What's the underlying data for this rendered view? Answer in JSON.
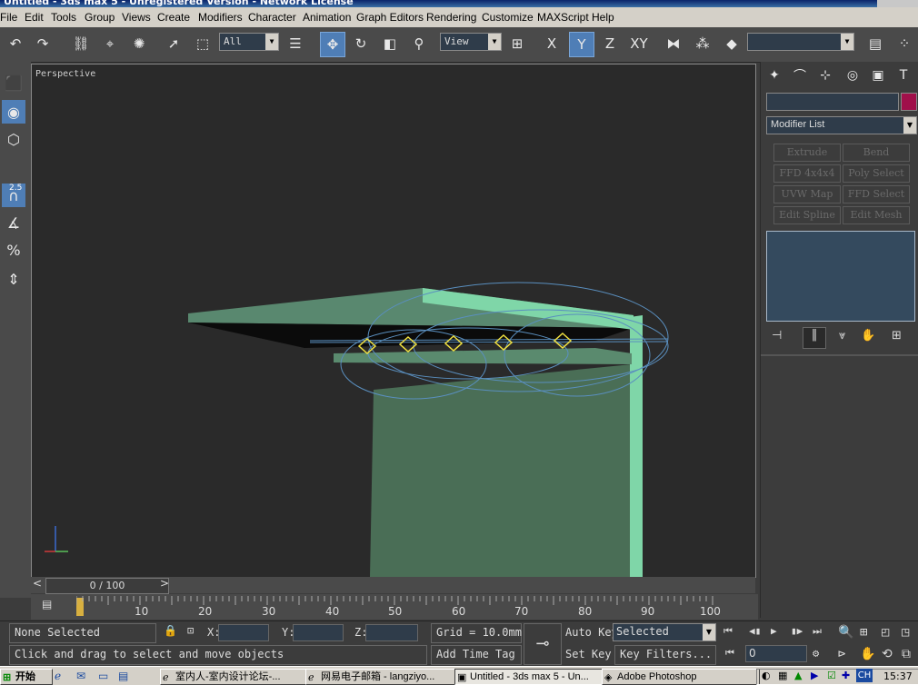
{
  "window": {
    "title": "Untitled - 3ds max 5 - Unregistered Version - Network License"
  },
  "menu": [
    "File",
    "Edit",
    "Tools",
    "Group",
    "Views",
    "Create",
    "Modifiers",
    "Character",
    "Animation",
    "Graph Editors",
    "Rendering",
    "Customize",
    "MAXScript",
    "Help"
  ],
  "toolbar": {
    "selection_filter": "All",
    "reference_coord": "View",
    "axis_x": "X",
    "axis_y": "Y",
    "axis_z": "Z",
    "axis_xy": "XY",
    "named_selection": ""
  },
  "left_tools": {
    "spinner_snap_value": "2.5",
    "percent_snap_label": "%"
  },
  "viewport": {
    "label": "Perspective"
  },
  "time_slider": {
    "value": "0 / 100",
    "prev": "<",
    "next": ">"
  },
  "timeline": {
    "ticks": [
      "10",
      "20",
      "30",
      "40",
      "50",
      "60",
      "70",
      "80",
      "90",
      "100"
    ]
  },
  "command_panel": {
    "object_name": "",
    "object_color": "#a0104a",
    "modifier_list": "Modifier List",
    "modifier_buttons": [
      "Extrude",
      "Bend",
      "FFD 4x4x4",
      "Poly Select",
      "UVW Map",
      "FFD Select",
      "Edit Spline",
      "Edit Mesh"
    ]
  },
  "status": {
    "selection": "None Selected",
    "prompt": "Click and drag to select and move objects",
    "x_label": "X:",
    "y_label": "Y:",
    "z_label": "Z:",
    "x_value": "",
    "y_value": "",
    "z_value": "",
    "grid": "Grid = 10.0mm",
    "add_time_tag": "Add Time Tag",
    "auto_key": "Auto Key",
    "set_key": "Set Key",
    "selected_dropdown": "Selected",
    "key_filters": "Key Filters...",
    "frame": "0"
  },
  "taskbar": {
    "start": "开始",
    "tasks": [
      "室内人-室内设计论坛-...",
      "网易电子邮箱 - langziyo...",
      "Untitled - 3ds max 5 - Un...",
      "Adobe Photoshop"
    ],
    "lang": "CH",
    "clock": "15:37"
  },
  "colors": {
    "accent": "#4f7eb6",
    "object_green": "#7fd6a8",
    "viewport_bg": "#2a2a2a"
  }
}
